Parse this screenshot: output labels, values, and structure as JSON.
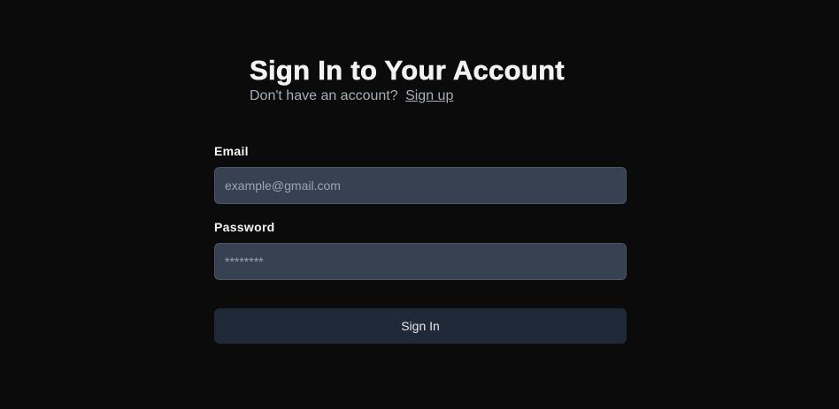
{
  "header": {
    "title": "Sign In to Your Account",
    "subtitle_text": "Don't have an account?",
    "signup_link": "Sign up"
  },
  "form": {
    "email": {
      "label": "Email",
      "placeholder": "example@gmail.com"
    },
    "password": {
      "label": "Password",
      "placeholder": "********"
    },
    "submit_label": "Sign In"
  },
  "colors": {
    "background": "#0b0b0c",
    "input_bg": "#374151",
    "button_bg": "#1f2937"
  }
}
